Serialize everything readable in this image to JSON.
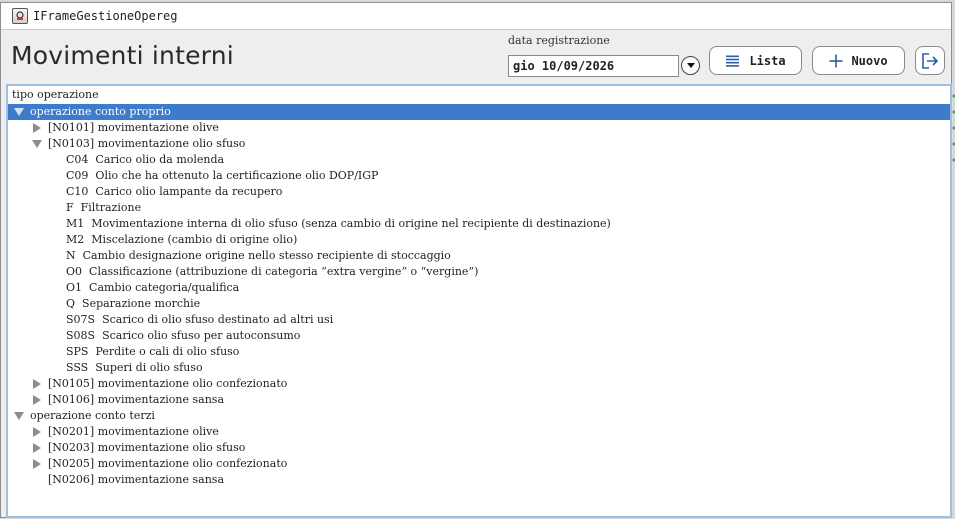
{
  "window": {
    "title": "IFrameGestioneOpereg"
  },
  "header": {
    "page_title": "Movimenti interni",
    "date_label": "data registrazione",
    "date_value": "gio 10/09/2026",
    "lista_label": "Lista",
    "nuovo_label": "Nuovo"
  },
  "tree": {
    "column_header": "tipo operazione",
    "rows": [
      {
        "level": 0,
        "label": "operazione conto proprio",
        "state": "expanded",
        "selected": true
      },
      {
        "level": 1,
        "label": "[N0101] movimentazione olive",
        "state": "collapsed"
      },
      {
        "level": 1,
        "label": "[N0103] movimentazione olio sfuso",
        "state": "expanded"
      },
      {
        "level": 2,
        "code": "C04",
        "label": "Carico olio da molenda",
        "state": "leaf"
      },
      {
        "level": 2,
        "code": "C09",
        "label": "Olio che ha ottenuto la certificazione olio DOP/IGP",
        "state": "leaf"
      },
      {
        "level": 2,
        "code": "C10",
        "label": "Carico olio lampante da recupero",
        "state": "leaf"
      },
      {
        "level": 2,
        "code": "F",
        "label": "Filtrazione",
        "state": "leaf"
      },
      {
        "level": 2,
        "code": "M1",
        "label": "Movimentazione interna di olio sfuso (senza cambio di origine nel recipiente di destinazione)",
        "state": "leaf"
      },
      {
        "level": 2,
        "code": "M2",
        "label": "Miscelazione (cambio di origine olio)",
        "state": "leaf"
      },
      {
        "level": 2,
        "code": "N",
        "label": "Cambio designazione origine nello stesso recipiente di stoccaggio",
        "state": "leaf"
      },
      {
        "level": 2,
        "code": "O0",
        "label": "Classificazione (attribuzione di categoria “extra vergine” o “vergine”)",
        "state": "leaf"
      },
      {
        "level": 2,
        "code": "O1",
        "label": "Cambio categoria/qualifica",
        "state": "leaf"
      },
      {
        "level": 2,
        "code": "Q",
        "label": "Separazione morchie",
        "state": "leaf"
      },
      {
        "level": 2,
        "code": "S07S",
        "label": "Scarico di olio sfuso destinato ad altri usi",
        "state": "leaf"
      },
      {
        "level": 2,
        "code": "S08S",
        "label": "Scarico olio sfuso per autoconsumo",
        "state": "leaf"
      },
      {
        "level": 2,
        "code": "SPS",
        "label": "Perdite o cali di olio sfuso",
        "state": "leaf"
      },
      {
        "level": 2,
        "code": "SSS",
        "label": "Superi di olio sfuso",
        "state": "leaf"
      },
      {
        "level": 1,
        "label": "[N0105] movimentazione olio confezionato",
        "state": "collapsed"
      },
      {
        "level": 1,
        "label": "[N0106] movimentazione sansa",
        "state": "collapsed"
      },
      {
        "level": 0,
        "label": "operazione conto terzi",
        "state": "expanded"
      },
      {
        "level": 1,
        "label": "[N0201] movimentazione olive",
        "state": "collapsed"
      },
      {
        "level": 1,
        "label": "[N0203] movimentazione olio sfuso",
        "state": "collapsed"
      },
      {
        "level": 1,
        "label": "[N0205] movimentazione olio confezionato",
        "state": "collapsed"
      },
      {
        "level": 1,
        "label": "[N0206] movimentazione sansa",
        "state": "none"
      }
    ]
  },
  "icons": {
    "app": "app-icon",
    "date_toggle": "chevron-down-icon",
    "lista": "list-icon",
    "nuovo": "plus-icon",
    "exit": "logout-icon",
    "expanded": "caret-down-icon",
    "collapsed": "caret-right-icon"
  },
  "colors": {
    "selection": "#3d7bcb",
    "panel_border": "#9fc0e6",
    "accent_icon": "#2b5fa8"
  }
}
